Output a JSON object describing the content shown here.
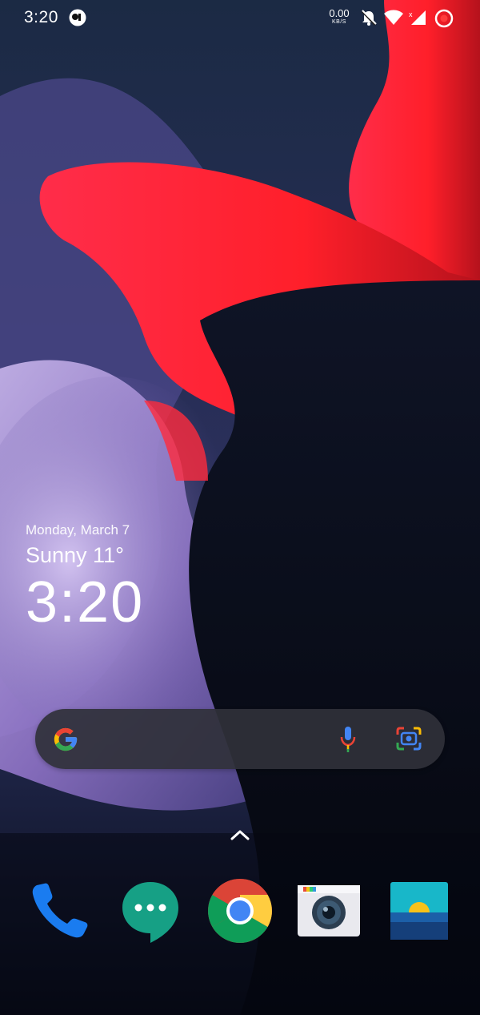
{
  "status_bar": {
    "time": "3:20",
    "net_rate_value": "0.00",
    "net_rate_unit": "KB/S",
    "icons": [
      "app-notification-icon",
      "mute-bell-icon",
      "wifi-icon",
      "no-signal-icon",
      "screen-record-icon"
    ]
  },
  "clock_widget": {
    "date": "Monday, March 7",
    "weather": "Sunny 11°",
    "time": "3:20"
  },
  "search_bar": {
    "icons": [
      "google-g-icon",
      "microphone-icon",
      "lens-icon"
    ]
  },
  "app_drawer": {
    "icon": "chevron-up-icon"
  },
  "dock": {
    "apps": [
      {
        "name": "phone-app-icon"
      },
      {
        "name": "messages-app-icon"
      },
      {
        "name": "chrome-app-icon"
      },
      {
        "name": "camera-app-icon"
      },
      {
        "name": "gallery-app-icon"
      }
    ]
  },
  "colors": {
    "accent_red": "#ff2b3a",
    "search_bg": "#30313a",
    "google_blue": "#4285F4",
    "google_red": "#EA4335",
    "google_yellow": "#FBBC05",
    "google_green": "#34A853"
  }
}
